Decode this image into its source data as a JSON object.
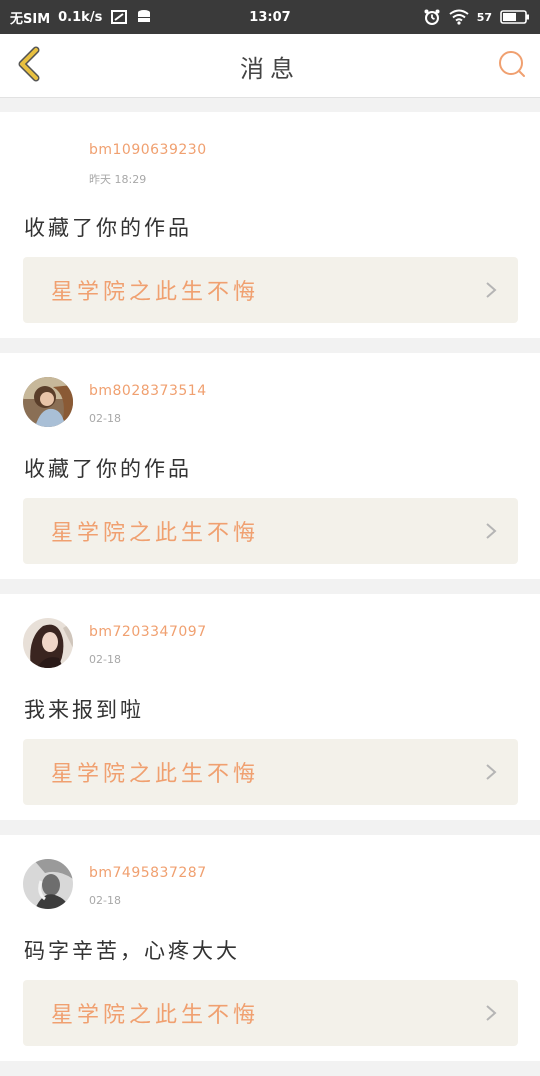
{
  "status_bar": {
    "carrier": "无SIM",
    "speed": "0.1k/s",
    "time": "13:07",
    "battery": "57"
  },
  "header": {
    "title": "消息"
  },
  "colors": {
    "accent": "#f0a070",
    "back_icon": "#e8c040",
    "card_bg": "#ffffff",
    "work_bg": "#f3f1ea"
  },
  "messages": [
    {
      "username": "bm1090639230",
      "time": "昨天 18:29",
      "action": "收藏了你的作品",
      "work_title": "星学院之此生不悔",
      "avatar": "none"
    },
    {
      "username": "bm8028373514",
      "time": "02-18",
      "action": "收藏了你的作品",
      "work_title": "星学院之此生不悔",
      "avatar": "girl-photo"
    },
    {
      "username": "bm7203347097",
      "time": "02-18",
      "action": "我来报到啦",
      "work_title": "星学院之此生不悔",
      "avatar": "woman-photo"
    },
    {
      "username": "bm7495837287",
      "time": "02-18",
      "action": "码字辛苦，心疼大大",
      "work_title": "星学院之此生不悔",
      "avatar": "bw-photo"
    }
  ]
}
